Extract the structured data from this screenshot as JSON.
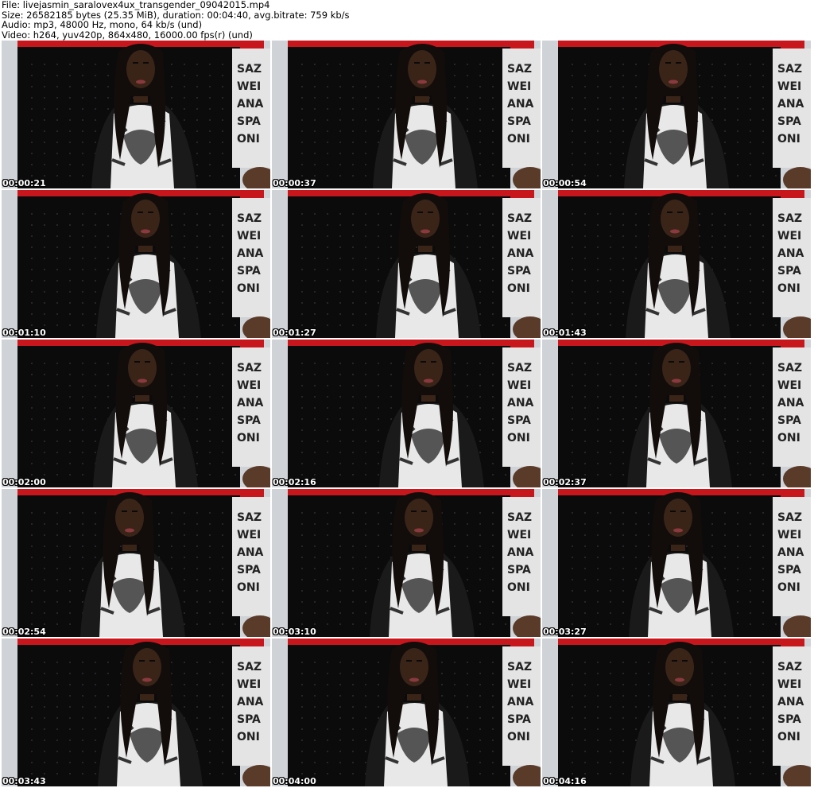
{
  "header": {
    "line1": "File: livejasmin_saralovex4ux_transgender_09042015.mp4",
    "line2": "Size: 26582185 bytes (25.35 MiB), duration: 00:04:40, avg.bitrate: 759 kb/s",
    "line3": "Audio: mp3, 48000 Hz, mono, 64 kb/s (und)",
    "line4": "Video: h264, yuv420p, 864x480, 16000.00 fps(r) (und)"
  },
  "thumbnails": [
    {
      "timestamp": "00:00:21"
    },
    {
      "timestamp": "00:00:37"
    },
    {
      "timestamp": "00:00:54"
    },
    {
      "timestamp": "00:01:10"
    },
    {
      "timestamp": "00:01:27"
    },
    {
      "timestamp": "00:01:43"
    },
    {
      "timestamp": "00:02:00"
    },
    {
      "timestamp": "00:02:16"
    },
    {
      "timestamp": "00:02:37"
    },
    {
      "timestamp": "00:02:54"
    },
    {
      "timestamp": "00:03:10"
    },
    {
      "timestamp": "00:03:27"
    },
    {
      "timestamp": "00:03:43"
    },
    {
      "timestamp": "00:04:00"
    },
    {
      "timestamp": "00:04:16"
    }
  ],
  "colors": {
    "background": "#ffffff",
    "wall": "#cfd2d6",
    "headboard": "#0b0b0c",
    "accent_red": "#c8161d",
    "skin": "#3a2418",
    "hair": "#120d0b",
    "top_white": "#e8e8e8",
    "top_black": "#1a1a1a"
  }
}
